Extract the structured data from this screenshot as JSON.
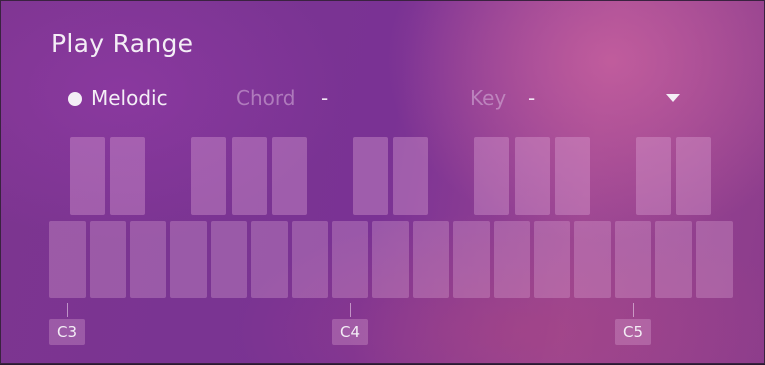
{
  "panel": {
    "title": "Play Range",
    "mode": {
      "melodic_label": "Melodic",
      "chord_label": "Chord",
      "chord_value": "-",
      "key_label": "Key",
      "key_value": "-",
      "selected": "Melodic"
    }
  },
  "keyboard": {
    "white_key_count": 17,
    "black_key_count": 12,
    "octave_labels": [
      "C3",
      "C4",
      "C5"
    ]
  },
  "colors": {
    "text_primary": "#f4eef6",
    "text_dim": "#d7b4dc",
    "background_purple": "#7a3294",
    "background_pink": "#cd64a0"
  },
  "icons": {
    "selected_indicator": "filled-dot-icon",
    "dropdown": "triangle-down-icon"
  }
}
